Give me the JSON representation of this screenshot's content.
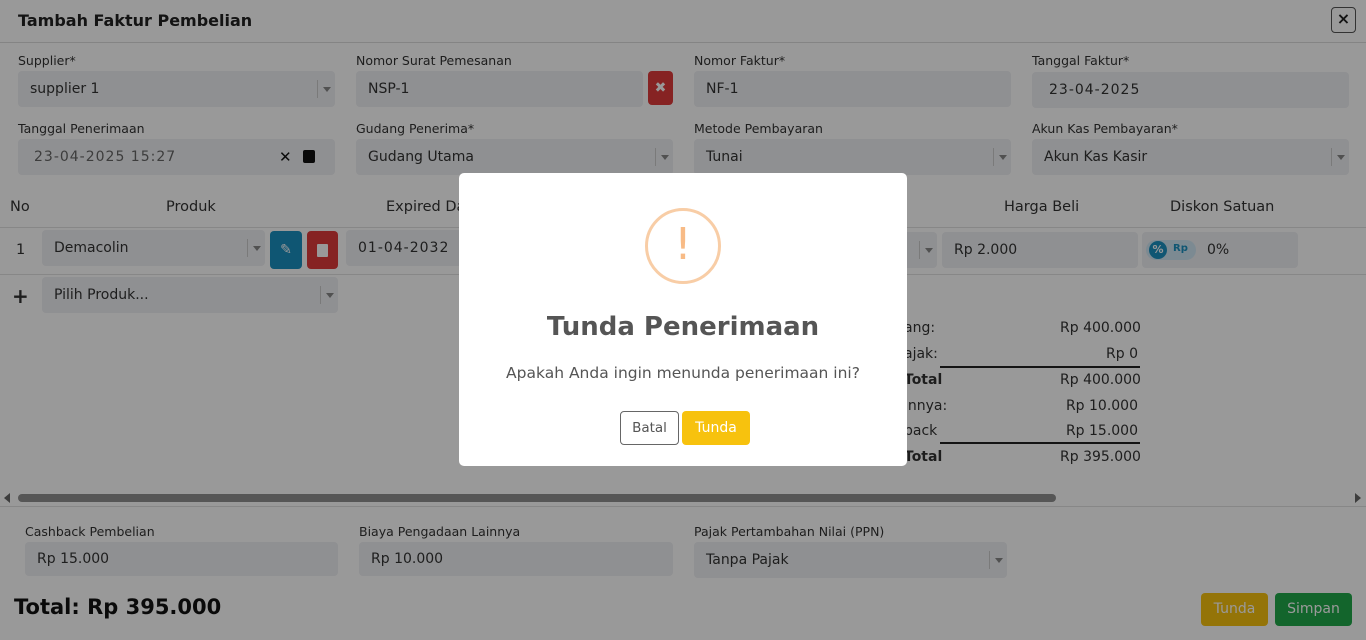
{
  "header": {
    "title": "Tambah Faktur Pembelian",
    "close_label": "×"
  },
  "form": {
    "supplier": {
      "label": "Supplier*",
      "value": "supplier 1"
    },
    "nomor_surat": {
      "label": "Nomor Surat Pemesanan",
      "value": "NSP-1"
    },
    "nomor_faktur": {
      "label": "Nomor Faktur*",
      "value": "NF-1"
    },
    "tanggal_faktur": {
      "label": "Tanggal Faktur*",
      "value": "23-04-2025"
    },
    "tanggal_penerimaan": {
      "label": "Tanggal Penerimaan",
      "value": "23-04-2025 15:27"
    },
    "gudang": {
      "label": "Gudang Penerima*",
      "value": "Gudang Utama"
    },
    "metode": {
      "label": "Metode Pembayaran",
      "value": "Tunai"
    },
    "akun_kas": {
      "label": "Akun Kas Pembayaran*",
      "value": "Akun Kas Kasir"
    }
  },
  "table": {
    "headers": {
      "no": "No",
      "produk": "Produk",
      "expired": "Expired Da",
      "harga": "Harga Beli",
      "diskon": "Diskon Satuan"
    },
    "row": {
      "no": "1",
      "produk": "Demacolin",
      "expired": "01-04-2032",
      "harga": "Rp 2.000",
      "diskon": "0%",
      "badge_pct": "%",
      "badge_rp": "Rp"
    },
    "add_label": "+",
    "add_placeholder": "Pilih Produk..."
  },
  "summary": [
    {
      "label": "ang:",
      "value": "Rp 400.000",
      "bold": false
    },
    {
      "label": "ajak:",
      "value": "Rp 0",
      "bold": false
    },
    {
      "label": "Total",
      "value": "Rp 400.000",
      "bold": true
    },
    {
      "label": "innya:",
      "value": "Rp 10.000",
      "bold": false
    },
    {
      "label": "back",
      "value": "Rp 15.000",
      "bold": false
    },
    {
      "label": "Total",
      "value": "Rp 395.000",
      "bold": true
    }
  ],
  "footer": {
    "cashback": {
      "label": "Cashback Pembelian",
      "value": "Rp 15.000"
    },
    "biaya": {
      "label": "Biaya Pengadaan Lainnya",
      "value": "Rp 10.000"
    },
    "ppn": {
      "label": "Pajak Pertambahan Nilai (PPN)",
      "value": "Tanpa Pajak"
    },
    "total": "Total: Rp 395.000",
    "tunda_label": "Tunda",
    "simpan_label": "Simpan"
  },
  "modal": {
    "icon": "!",
    "title": "Tunda Penerimaan",
    "text": "Apakah Anda ingin menunda penerimaan ini?",
    "cancel_label": "Batal",
    "confirm_label": "Tunda"
  },
  "colors": {
    "primary_yellow": "#f7c20e",
    "success_green": "#21a84a",
    "danger_red": "#e03b3b",
    "info_blue": "#1a8fc0"
  }
}
